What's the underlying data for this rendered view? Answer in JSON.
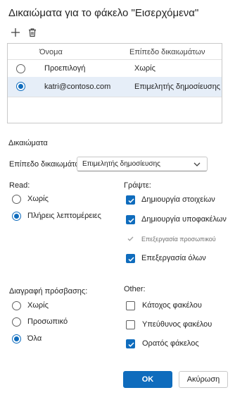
{
  "dialog": {
    "title": "Δικαιώματα για το φάκελο \"Εισερχόμενα\"",
    "toolbar": {
      "add_icon": "plus-icon",
      "delete_icon": "trash-icon"
    },
    "table": {
      "columns": [
        "Όνομα",
        "Επίπεδο δικαιωμάτων"
      ],
      "rows": [
        {
          "name": "Προεπιλογή",
          "level": "Χωρίς",
          "selected": false
        },
        {
          "name": "katri@contoso.com",
          "level": "Επιμελητής δημοσίευσης",
          "selected": true
        }
      ]
    },
    "permissions": {
      "section_label": "Δικαιώματα",
      "level_label": "Επίπεδο δικαιωμάτων",
      "level_value": "Επιμελητής δημοσίευσης"
    },
    "read": {
      "label": "Read:",
      "options": [
        {
          "label": "Χωρίς",
          "selected": false
        },
        {
          "label": "Πλήρεις λεπτομέρειες",
          "selected": true
        }
      ]
    },
    "write": {
      "label": "Γράψτε:",
      "options": [
        {
          "label": "Δημιουργία στοιχείων",
          "checked": true,
          "disabled": false
        },
        {
          "label": "Δημιουργία υποφακέλων",
          "checked": true,
          "disabled": false
        },
        {
          "label": "Επεξεργασία προσωπικού",
          "checked": true,
          "disabled": true
        },
        {
          "label": "Επεξεργασία όλων",
          "checked": true,
          "disabled": false
        }
      ]
    },
    "delete_access": {
      "label": "Διαγραφή πρόσβασης:",
      "options": [
        {
          "label": "Χωρίς",
          "selected": false
        },
        {
          "label": "Προσωπικό",
          "selected": false
        },
        {
          "label": "Όλα",
          "selected": true
        }
      ]
    },
    "other": {
      "label": "Other:",
      "options": [
        {
          "label": "Κάτοχος φακέλου",
          "checked": false
        },
        {
          "label": "Υπεύθυνος φακέλου",
          "checked": false
        },
        {
          "label": "Ορατός φάκελος",
          "checked": true
        }
      ]
    },
    "buttons": {
      "ok": "OK",
      "cancel": "Ακύρωση"
    },
    "colors": {
      "accent": "#0f6cbd",
      "selected_row": "#e6eef8"
    }
  }
}
